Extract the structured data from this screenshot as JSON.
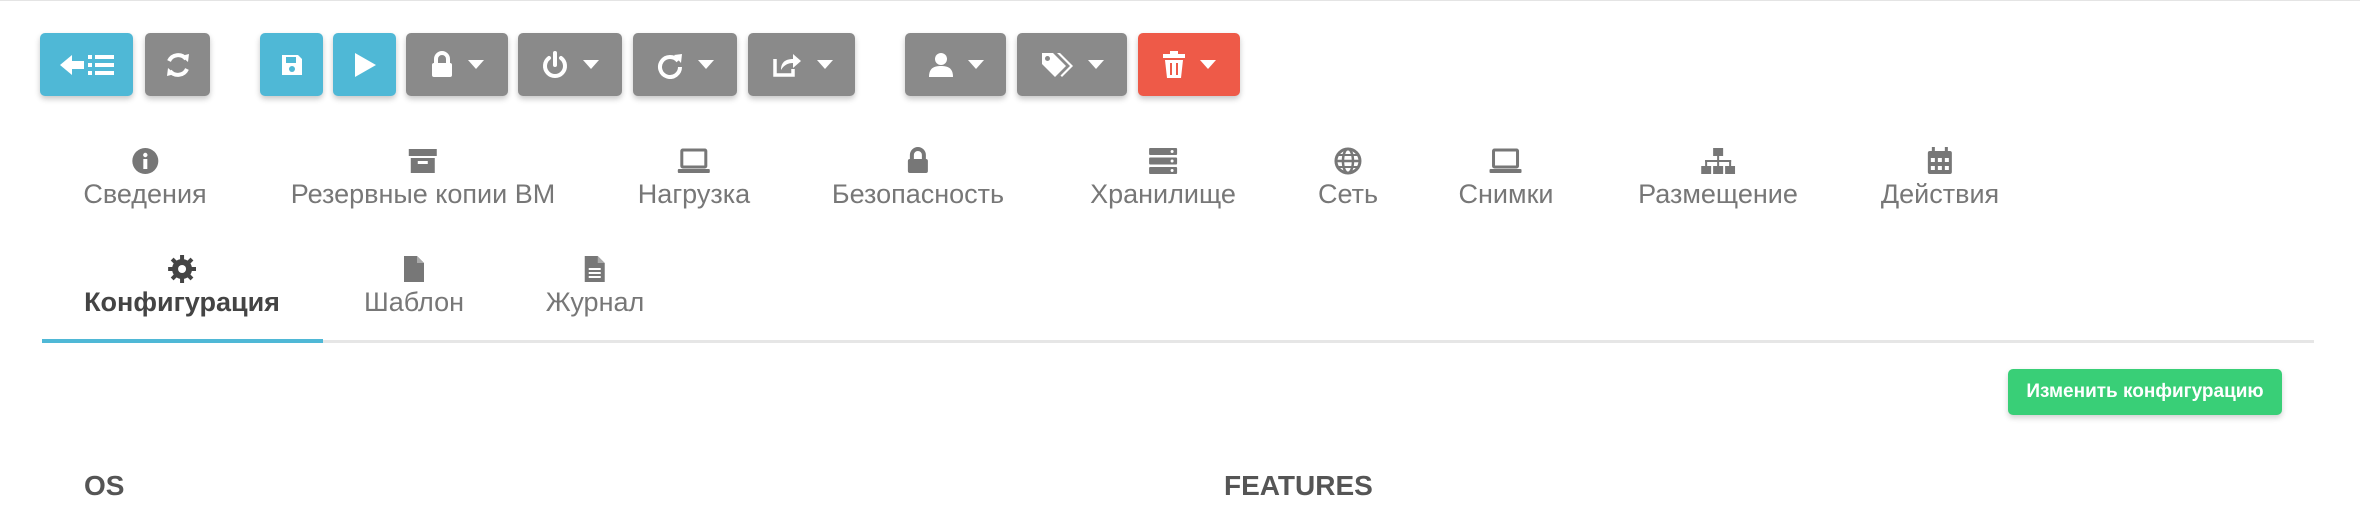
{
  "toolbar": {
    "buttons": [
      {
        "name": "back-to-list",
        "icon": "arrow-left-list-icon",
        "color": "#4fb8d6"
      },
      {
        "name": "refresh",
        "icon": "refresh-icon",
        "color": "#8a8a8a"
      },
      {
        "name": "save",
        "icon": "save-icon",
        "color": "#4fb8d6"
      },
      {
        "name": "play",
        "icon": "play-icon",
        "color": "#4fb8d6"
      },
      {
        "name": "lock-menu",
        "icon": "lock-icon",
        "color": "#8a8a8a"
      },
      {
        "name": "power-menu",
        "icon": "power-icon",
        "color": "#8a8a8a"
      },
      {
        "name": "reboot-menu",
        "icon": "redo-icon",
        "color": "#8a8a8a"
      },
      {
        "name": "migrate-menu",
        "icon": "share-icon",
        "color": "#8a8a8a"
      },
      {
        "name": "user-menu",
        "icon": "user-icon",
        "color": "#8a8a8a"
      },
      {
        "name": "labels-menu",
        "icon": "tags-icon",
        "color": "#8a8a8a"
      },
      {
        "name": "delete-menu",
        "icon": "trash-icon",
        "color": "#ee5a48"
      }
    ]
  },
  "tabs": {
    "primary": [
      {
        "label": "Сведения",
        "icon": "info-icon"
      },
      {
        "label": "Резервные копии ВМ",
        "icon": "archive-icon"
      },
      {
        "label": "Нагрузка",
        "icon": "laptop-icon"
      },
      {
        "label": "Безопасность",
        "icon": "lock-icon"
      },
      {
        "label": "Хранилище",
        "icon": "server-icon"
      },
      {
        "label": "Сеть",
        "icon": "globe-icon"
      },
      {
        "label": "Снимки",
        "icon": "laptop-icon"
      },
      {
        "label": "Размещение",
        "icon": "sitemap-icon"
      },
      {
        "label": "Действия",
        "icon": "calendar-icon"
      }
    ],
    "secondary": [
      {
        "label": "Конфигурация",
        "icon": "gear-icon",
        "active": true
      },
      {
        "label": "Шаблон",
        "icon": "file-icon"
      },
      {
        "label": "Журнал",
        "icon": "file-text-icon"
      }
    ]
  },
  "content": {
    "edit_button_label": "Изменить конфигурацию",
    "os_title": "OS",
    "features_title": "FEATURES"
  },
  "colors": {
    "blue": "#4fb8d6",
    "gray": "#8a8a8a",
    "red": "#ee5a48",
    "green": "#39cf77",
    "active_tab_underline": "#4fb8d6"
  }
}
